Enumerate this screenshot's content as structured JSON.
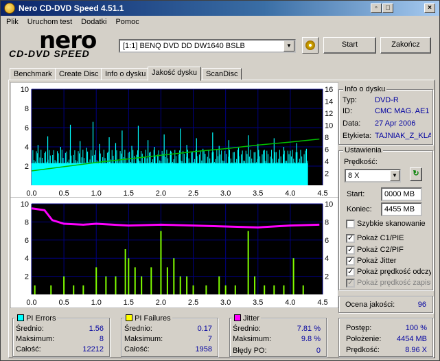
{
  "window": {
    "title": "Nero CD-DVD Speed 4.51.1"
  },
  "menu": [
    "Plik",
    "Uruchom test",
    "Dodatki",
    "Pomoc"
  ],
  "logo": {
    "nero": "nero",
    "sub": "CD-DVD SPEED"
  },
  "drive": {
    "selected": "[1:1]  BENQ DVD DD DW1640 BSLB"
  },
  "buttons": {
    "start": "Start",
    "exit": "Zakończ"
  },
  "tabs": [
    "Benchmark",
    "Create Disc",
    "Info o dysku",
    "Jakość dysku",
    "ScanDisc"
  ],
  "active_tab": 3,
  "disc_info": {
    "title": "Info o dysku",
    "rows": [
      {
        "label": "Typ:",
        "value": "DVD-R"
      },
      {
        "label": "ID:",
        "value": "CMC MAG. AE1"
      },
      {
        "label": "Data:",
        "value": "27 Apr 2006"
      },
      {
        "label": "Etykieta:",
        "value": "TAJNIAK_Z_KLA"
      }
    ]
  },
  "settings": {
    "title": "Ustawienia",
    "speed_label": "Prędkość:",
    "speed_value": "8 X",
    "start_label": "Start:",
    "start_value": "0000 MB",
    "end_label": "Koniec:",
    "end_value": "4455 MB",
    "checkboxes": [
      {
        "label": "Szybkie skanowanie",
        "checked": false,
        "enabled": true
      },
      {
        "label": "Pokaż C1/PIE",
        "checked": true,
        "enabled": true
      },
      {
        "label": "Pokaż C2/PIF",
        "checked": true,
        "enabled": true
      },
      {
        "label": "Pokaż Jitter",
        "checked": true,
        "enabled": true
      },
      {
        "label": "Pokaż prędkość odczytu",
        "checked": true,
        "enabled": true
      },
      {
        "label": "Pokaż prędkość zapisu",
        "checked": true,
        "enabled": false
      }
    ]
  },
  "quality": {
    "label": "Ocena jakości:",
    "value": "96"
  },
  "stats": {
    "pie": {
      "title": "PI Errors",
      "color": "#00ffff",
      "avg_label": "Średnio:",
      "avg": "1.56",
      "max_label": "Maksimum:",
      "max": "8",
      "total_label": "Całość:",
      "total": "12212"
    },
    "pif": {
      "title": "PI Failures",
      "color": "#ffff00",
      "avg_label": "Średnio:",
      "avg": "0.17",
      "max_label": "Maksimum:",
      "max": "7",
      "total_label": "Całość:",
      "total": "1958"
    },
    "jitter": {
      "title": "Jitter",
      "color": "#ff00ff",
      "avg_label": "Średnio:",
      "avg": "7.81 %",
      "max_label": "Maksimum:",
      "max": "9.8 %",
      "po_label": "Błędy PO:",
      "po": "0"
    }
  },
  "progress": {
    "rows": [
      {
        "label": "Postęp:",
        "value": "100 %"
      },
      {
        "label": "Położenie:",
        "value": "4454 MB"
      },
      {
        "label": "Prędkość:",
        "value": "8.96 X"
      }
    ]
  },
  "colors": {
    "pie": "#00ffff",
    "speed": "#00c000",
    "pif": "#80ff00",
    "jitter": "#ff00ff",
    "plot_bg": "#000000",
    "grid": "#000080"
  },
  "chart_data": [
    {
      "type": "bar",
      "name": "PI Errors / read speed",
      "x_range": [
        0,
        4.5
      ],
      "x_ticks": [
        "0.0",
        "0.5",
        "1.0",
        "1.5",
        "2.0",
        "2.5",
        "3.0",
        "3.5",
        "4.0",
        "4.5"
      ],
      "y_left_ticks": [
        "2",
        "4",
        "6",
        "8",
        "10"
      ],
      "y_right_ticks": [
        "2",
        "4",
        "6",
        "8",
        "10",
        "12",
        "14",
        "16"
      ],
      "ylim_left": [
        0,
        10
      ],
      "ylim_right": [
        0,
        16
      ],
      "pie_baseline": 2.3,
      "pie_spikes": [
        [
          0.1,
          4.2
        ],
        [
          0.25,
          5.1
        ],
        [
          0.45,
          4.0
        ],
        [
          0.6,
          6.3
        ],
        [
          0.75,
          4.6
        ],
        [
          0.85,
          3.9
        ],
        [
          0.95,
          6.6
        ],
        [
          1.05,
          4.3
        ],
        [
          1.2,
          5.0
        ],
        [
          1.3,
          4.4
        ],
        [
          1.4,
          5.7
        ],
        [
          1.55,
          4.1
        ],
        [
          1.65,
          6.2
        ],
        [
          1.8,
          4.7
        ],
        [
          1.9,
          4.0
        ],
        [
          2.05,
          5.3
        ],
        [
          2.15,
          3.6
        ],
        [
          2.3,
          5.9
        ],
        [
          2.4,
          4.2
        ],
        [
          2.55,
          4.9
        ],
        [
          2.65,
          3.8
        ],
        [
          2.8,
          5.5
        ],
        [
          2.9,
          4.1
        ],
        [
          3.05,
          4.7
        ],
        [
          3.2,
          3.9
        ],
        [
          3.35,
          5.2
        ],
        [
          3.5,
          4.3
        ],
        [
          3.6,
          3.7
        ],
        [
          3.75,
          4.9
        ],
        [
          3.9,
          4.0
        ],
        [
          4.0,
          3.6
        ],
        [
          4.1,
          4.4
        ],
        [
          4.25,
          3.8
        ]
      ],
      "speed_line": [
        [
          0,
          2.4
        ],
        [
          0.5,
          3.1
        ],
        [
          1.0,
          3.8
        ],
        [
          1.5,
          4.4
        ],
        [
          2.0,
          5.0
        ],
        [
          2.5,
          5.6
        ],
        [
          3.0,
          6.1
        ],
        [
          3.5,
          6.7
        ],
        [
          4.0,
          7.2
        ],
        [
          4.45,
          7.7
        ]
      ]
    },
    {
      "type": "bar",
      "name": "PI Failures / jitter",
      "x_range": [
        0,
        4.5
      ],
      "x_ticks": [
        "0.0",
        "0.5",
        "1.0",
        "1.5",
        "2.0",
        "2.5",
        "3.0",
        "3.5",
        "4.0",
        "4.5"
      ],
      "y_left_ticks": [
        "2",
        "4",
        "6",
        "8",
        "10"
      ],
      "y_right_ticks": [
        "2",
        "4",
        "6",
        "8",
        "10"
      ],
      "ylim": [
        0,
        10
      ],
      "pif_spikes": [
        [
          0.05,
          1
        ],
        [
          0.3,
          1
        ],
        [
          0.5,
          2
        ],
        [
          0.65,
          1
        ],
        [
          0.8,
          1
        ],
        [
          1.0,
          3
        ],
        [
          1.15,
          2
        ],
        [
          1.3,
          2
        ],
        [
          1.45,
          5
        ],
        [
          1.5,
          4
        ],
        [
          1.6,
          3
        ],
        [
          1.7,
          2
        ],
        [
          1.85,
          3
        ],
        [
          2.0,
          7
        ],
        [
          2.1,
          3
        ],
        [
          2.2,
          4
        ],
        [
          2.3,
          2
        ],
        [
          2.4,
          2
        ],
        [
          2.5,
          1
        ],
        [
          2.7,
          1
        ],
        [
          2.9,
          2
        ],
        [
          3.0,
          1
        ],
        [
          3.15,
          1
        ],
        [
          3.35,
          7
        ],
        [
          3.45,
          2
        ],
        [
          3.6,
          1
        ],
        [
          3.75,
          1
        ],
        [
          3.9,
          1
        ],
        [
          4.05,
          4
        ],
        [
          4.2,
          1
        ]
      ],
      "jitter_line": [
        [
          0,
          9.5
        ],
        [
          0.2,
          9.3
        ],
        [
          0.32,
          8.2
        ],
        [
          0.5,
          7.8
        ],
        [
          0.8,
          7.7
        ],
        [
          1.0,
          7.8
        ],
        [
          1.5,
          7.6
        ],
        [
          2.0,
          7.7
        ],
        [
          2.5,
          7.6
        ],
        [
          3.0,
          7.5
        ],
        [
          3.5,
          7.4
        ],
        [
          4.0,
          7.6
        ],
        [
          4.45,
          7.7
        ]
      ]
    }
  ]
}
